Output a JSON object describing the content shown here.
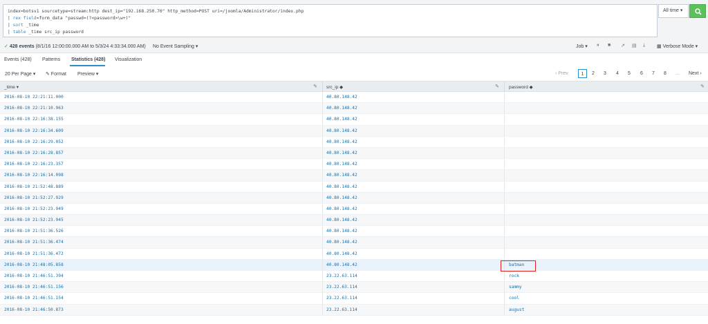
{
  "search": {
    "line1": "index=botsv1 sourcetype=stream:http dest_ip=\"192.168.250.70\" http_method=POST uri=/joomla/Administrator/index.php",
    "line2_pipe": "| ",
    "line2_kw": "rex",
    "line2_field": " field",
    "line2_rest": "=form_data \"passwd=(?<password>\\w+)\"",
    "line3_pipe": "| ",
    "line3_kw": "sort",
    "line3_rest": " _time",
    "line4_pipe": "| ",
    "line4_kw": "table",
    "line4_rest": "  _time src_ip password",
    "time_range": "All time ▾"
  },
  "status": {
    "event_count": "428 events",
    "range": "(8/1/16 12:00:00.000 AM to 5/3/24 4:33:34.000 AM)",
    "sampling": "No Event Sampling ▾",
    "job": "Job ▾",
    "mode": "Verbose Mode ▾"
  },
  "tabs": [
    {
      "label": "Events (428)"
    },
    {
      "label": "Patterns"
    },
    {
      "label": "Statistics (428)"
    },
    {
      "label": "Visualization"
    }
  ],
  "controls": {
    "per_page": "20 Per Page ▾",
    "format": "✎ Format",
    "preview": "Preview ▾",
    "prev": "‹ Prev",
    "pages": [
      "1",
      "2",
      "3",
      "4",
      "5",
      "6",
      "7",
      "8"
    ],
    "ellipsis": "...",
    "next": "Next ›"
  },
  "table": {
    "headers": [
      "_time ▾",
      "src_ip ◆",
      "password ◆"
    ],
    "rows": [
      [
        "2016-08-10 22:21:11.000",
        "40.80.148.42",
        ""
      ],
      [
        "2016-08-10 22:21:10.963",
        "40.80.148.42",
        ""
      ],
      [
        "2016-08-10 22:16:38.155",
        "40.80.148.42",
        ""
      ],
      [
        "2016-08-10 22:16:34.609",
        "40.80.148.42",
        ""
      ],
      [
        "2016-08-10 22:16:29.052",
        "40.80.148.42",
        ""
      ],
      [
        "2016-08-10 22:16:28.857",
        "40.80.148.42",
        ""
      ],
      [
        "2016-08-10 22:16:23.357",
        "40.80.148.42",
        ""
      ],
      [
        "2016-08-10 22:16:14.098",
        "40.80.148.42",
        ""
      ],
      [
        "2016-08-10 21:52:48.889",
        "40.80.148.42",
        ""
      ],
      [
        "2016-08-10 21:52:27.929",
        "40.80.148.42",
        ""
      ],
      [
        "2016-08-10 21:52:23.949",
        "40.80.148.42",
        ""
      ],
      [
        "2016-08-10 21:52:23.945",
        "40.80.148.42",
        ""
      ],
      [
        "2016-08-10 21:51:36.526",
        "40.80.148.42",
        ""
      ],
      [
        "2016-08-10 21:51:36.474",
        "40.80.148.42",
        ""
      ],
      [
        "2016-08-10 21:51:36.472",
        "40.80.148.42",
        ""
      ],
      [
        "2016-08-10 21:48:05.858",
        "40.80.148.42",
        "batman"
      ],
      [
        "2016-08-10 21:46:51.394",
        "23.22.63.114",
        "rock"
      ],
      [
        "2016-08-10 21:46:51.156",
        "23.22.63.114",
        "sammy"
      ],
      [
        "2016-08-10 21:46:51.154",
        "23.22.63.114",
        "cool"
      ],
      [
        "2016-08-10 21:46:50.873",
        "23.22.63.114",
        "august"
      ]
    ]
  },
  "colors": {
    "accent": "#2a8ccc",
    "success": "#5cc05c",
    "highlight_box": "#e0201b"
  }
}
